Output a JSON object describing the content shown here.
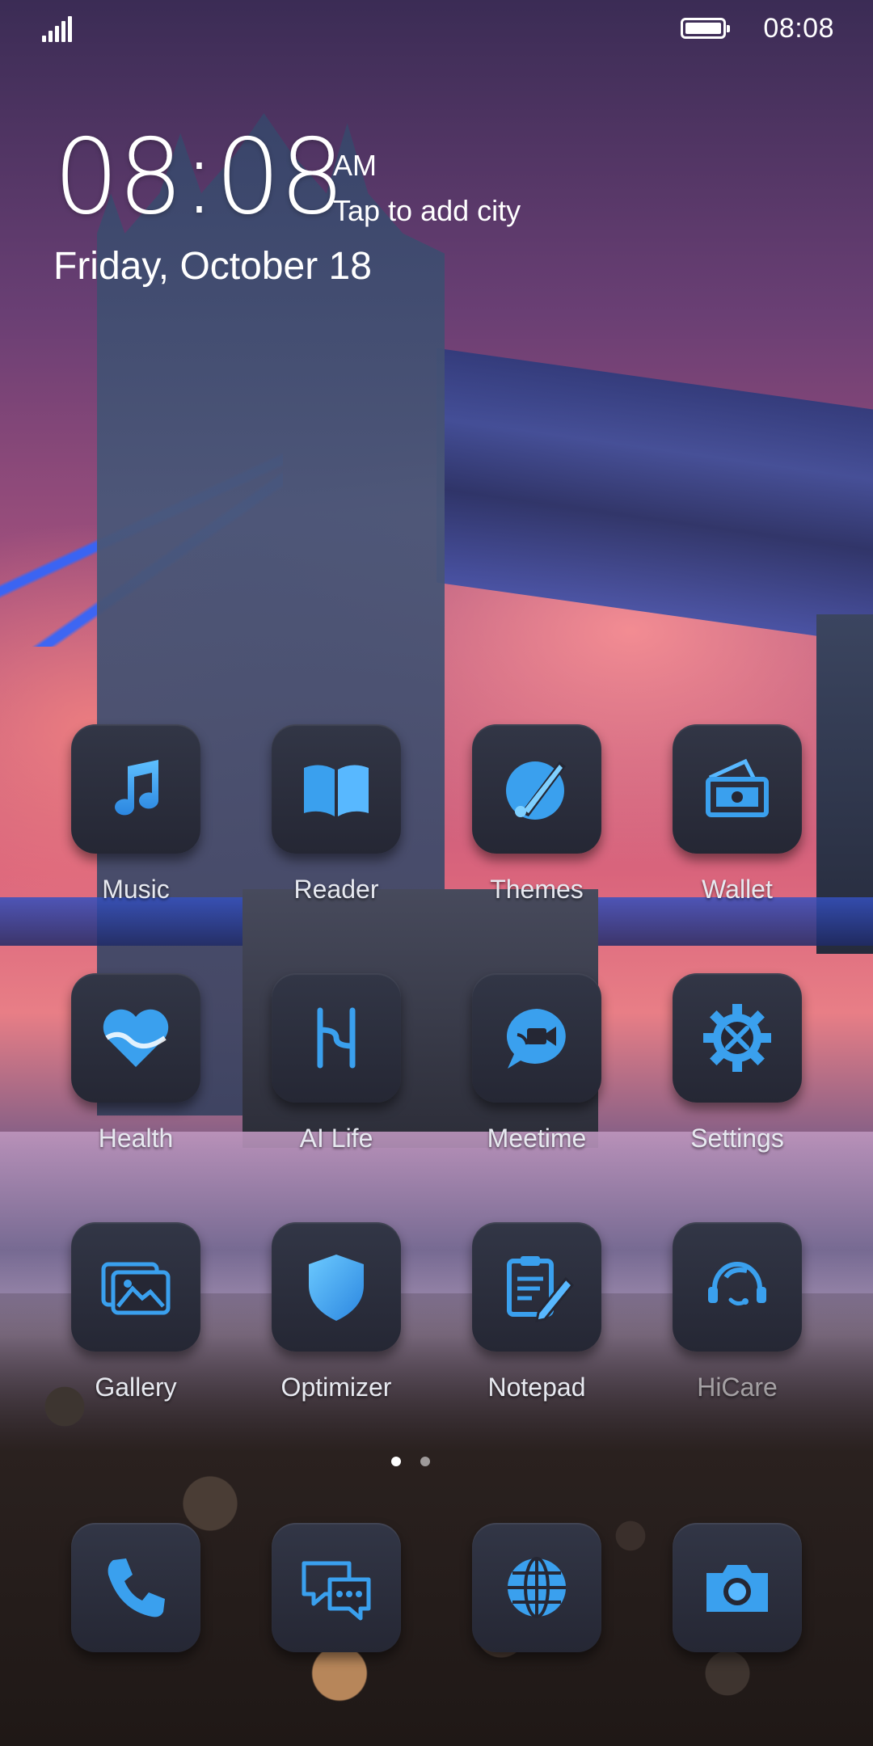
{
  "status_bar": {
    "time": "08:08",
    "signal_icon": "signal-bars-icon",
    "battery_icon": "battery-full-icon"
  },
  "clock_widget": {
    "time": "08:08",
    "ampm": "AM",
    "add_city": "Tap to add city",
    "date": "Friday, October 18"
  },
  "colors": {
    "icon_blue": "#3aa0ee",
    "tile_dark": "#2a2c3a"
  },
  "apps": [
    {
      "label": "Music",
      "icon": "music-note-icon"
    },
    {
      "label": "Reader",
      "icon": "open-book-icon"
    },
    {
      "label": "Themes",
      "icon": "brush-palette-icon"
    },
    {
      "label": "Wallet",
      "icon": "wallet-cash-icon"
    },
    {
      "label": "Health",
      "icon": "heart-icon"
    },
    {
      "label": "AI Life",
      "icon": "ai-life-icon"
    },
    {
      "label": "Meetime",
      "icon": "video-chat-icon"
    },
    {
      "label": "Settings",
      "icon": "gear-tools-icon"
    },
    {
      "label": "Gallery",
      "icon": "photo-gallery-icon"
    },
    {
      "label": "Optimizer",
      "icon": "shield-icon"
    },
    {
      "label": "Notepad",
      "icon": "clipboard-pencil-icon"
    },
    {
      "label": "HiCare",
      "icon": "headset-support-icon"
    }
  ],
  "dock": [
    {
      "icon": "phone-icon"
    },
    {
      "icon": "messages-icon"
    },
    {
      "icon": "browser-globe-icon"
    },
    {
      "icon": "camera-icon"
    }
  ],
  "page_indicator": {
    "pages": 2,
    "current": 1
  }
}
